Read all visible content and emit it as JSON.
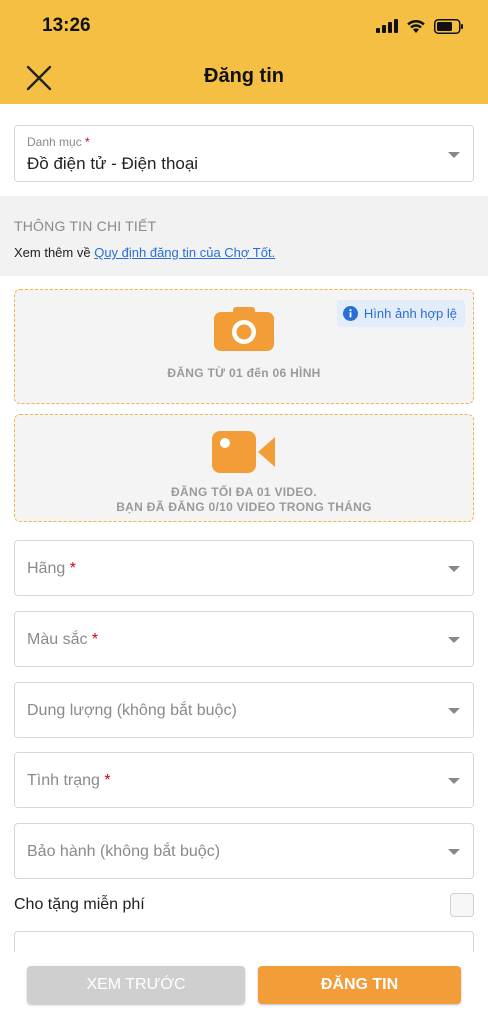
{
  "status_bar": {
    "time": "13:26"
  },
  "header": {
    "title": "Đăng tin",
    "close_icon": "close-icon"
  },
  "category": {
    "label": "Danh mục",
    "required_mark": "*",
    "value": "Đồ điện tử - Điện thoại"
  },
  "details": {
    "title": "THÔNG TIN CHI TIẾT",
    "note_prefix": "Xem thêm về ",
    "note_link": "Quy định đăng tin của Chợ Tốt."
  },
  "photo_upload": {
    "icon": "camera-icon",
    "text": "ĐĂNG TỪ 01 đến 06 HÌNH",
    "badge": "Hình ảnh hợp lệ"
  },
  "video_upload": {
    "icon": "video-camera-icon",
    "line1": "ĐĂNG TỐI ĐA 01 VIDEO.",
    "line2": "BẠN ĐÃ ĐĂNG 0/10 VIDEO TRONG THÁNG"
  },
  "fields": {
    "brand": {
      "label": "Hãng",
      "required_mark": "*"
    },
    "color": {
      "label": "Màu sắc",
      "required_mark": "*"
    },
    "capacity": {
      "label": "Dung lượng (không bắt buộc)"
    },
    "condition": {
      "label": "Tình trạng",
      "required_mark": "*"
    },
    "warranty": {
      "label": "Bảo hành (không bắt buộc)"
    }
  },
  "giveaway": {
    "label": "Cho tặng miễn phí",
    "checked": false
  },
  "footer": {
    "preview_label": "XEM TRƯỚC",
    "post_label": "ĐĂNG TIN"
  },
  "colors": {
    "header": "#f4bf42",
    "accent": "#f29d38",
    "link": "#2a6fd6",
    "required": "#d0021b"
  }
}
